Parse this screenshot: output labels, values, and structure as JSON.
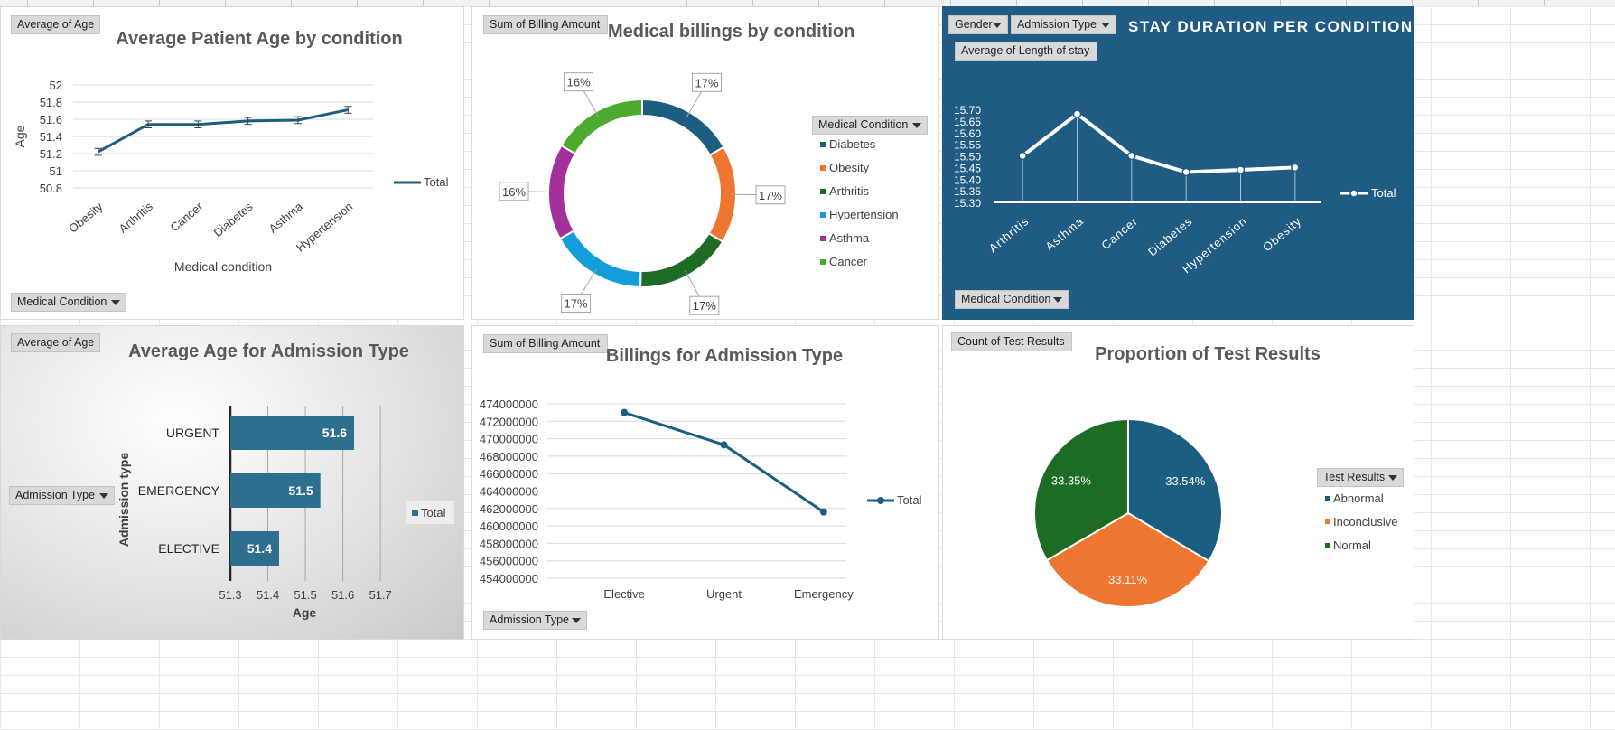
{
  "chart_data": [
    {
      "type": "line",
      "title": "Average Patient Age by  condition",
      "field_button": "Average of Age",
      "axis_field_button": "Medical Condition",
      "xlabel": "Medical condition",
      "ylabel": "Age",
      "categories": [
        "Obesity",
        "Arthritis",
        "Cancer",
        "Diabetes",
        "Asthma",
        "Hypertension"
      ],
      "series": [
        {
          "name": "Total",
          "values": [
            51.22,
            51.54,
            51.54,
            51.58,
            51.59,
            51.71
          ]
        }
      ],
      "error_bars": true,
      "ylim": [
        50.8,
        52
      ],
      "yticks": [
        "50.8",
        "51",
        "51.2",
        "51.4",
        "51.6",
        "51.8",
        "52"
      ],
      "legend": "right",
      "color": "#1b5e82"
    },
    {
      "type": "pie",
      "variant": "donut",
      "title": "Medical billings by condition",
      "field_button": "Sum of Billing Amount",
      "legend_title": "Medical Condition",
      "labels": [
        "Diabetes",
        "Obesity",
        "Arthritis",
        "Hypertension",
        "Asthma",
        "Cancer"
      ],
      "values": [
        16.8,
        16.8,
        16.7,
        16.7,
        16.5,
        16.5
      ],
      "data_labels": [
        "17%",
        "17%",
        "17%",
        "17%",
        "16%",
        "16%"
      ],
      "colors": [
        "#1b5e82",
        "#ee7630",
        "#1e6b24",
        "#139ddb",
        "#a3309b",
        "#4caa2f"
      ],
      "legend": "right"
    },
    {
      "type": "line",
      "title": "STAY DURATION PER CONDITION",
      "field_buttons": [
        "Gender",
        "Admission Type"
      ],
      "value_button": "Average of Length of stay",
      "axis_field_button": "Medical Condition",
      "categories": [
        "Arthritis",
        "Asthma",
        "Cancer",
        "Diabetes",
        "Hypertension",
        "Obesity"
      ],
      "series": [
        {
          "name": "Total",
          "values": [
            15.5,
            15.68,
            15.5,
            15.43,
            15.44,
            15.45
          ]
        }
      ],
      "ylim": [
        15.3,
        15.7
      ],
      "yticks": [
        "15.30",
        "15.35",
        "15.40",
        "15.45",
        "15.50",
        "15.55",
        "15.60",
        "15.65",
        "15.70"
      ],
      "legend": "right",
      "background": "#1f5b82"
    },
    {
      "type": "bar",
      "orientation": "horizontal",
      "title": "Average Age for Admission Type",
      "field_button": "Average of Age",
      "axis_field_button": "Admission Type",
      "categories": [
        "URGENT",
        "EMERGENCY",
        "ELECTIVE"
      ],
      "series": [
        {
          "name": "Total",
          "values": [
            51.6,
            51.5,
            51.4
          ]
        }
      ],
      "bar_values": [
        51.63,
        51.54,
        51.43
      ],
      "xlim": [
        51.3,
        51.7
      ],
      "xticks": [
        "51.3",
        "51.4",
        "51.5",
        "51.6",
        "51.7"
      ],
      "xlabel": "Age",
      "ylabel": "Admission type",
      "legend": "right",
      "color": "#2e6f8e"
    },
    {
      "type": "line",
      "title": "Billings for Admission Type",
      "field_button": "Sum of Billing Amount",
      "axis_field_button": "Admission Type",
      "categories": [
        "Elective",
        "Urgent",
        "Emergency"
      ],
      "series": [
        {
          "name": "Total",
          "values": [
            473000000,
            469300000,
            461600000
          ]
        }
      ],
      "ylim": [
        454000000,
        474000000
      ],
      "yticks": [
        "454000000",
        "456000000",
        "458000000",
        "460000000",
        "462000000",
        "464000000",
        "466000000",
        "468000000",
        "470000000",
        "472000000",
        "474000000"
      ],
      "legend": "right",
      "color": "#1b5e82"
    },
    {
      "type": "pie",
      "title": "Proportion of Test Results",
      "field_button": "Count of Test Results",
      "legend_title": "Test Results",
      "labels": [
        "Abnormal",
        "Inconclusive",
        "Normal"
      ],
      "values": [
        33.54,
        33.11,
        33.35
      ],
      "data_labels": [
        "33.54%",
        "33.11%",
        "33.35%"
      ],
      "colors": [
        "#1b5e82",
        "#ee7630",
        "#1e6b24"
      ],
      "legend": "right"
    }
  ]
}
